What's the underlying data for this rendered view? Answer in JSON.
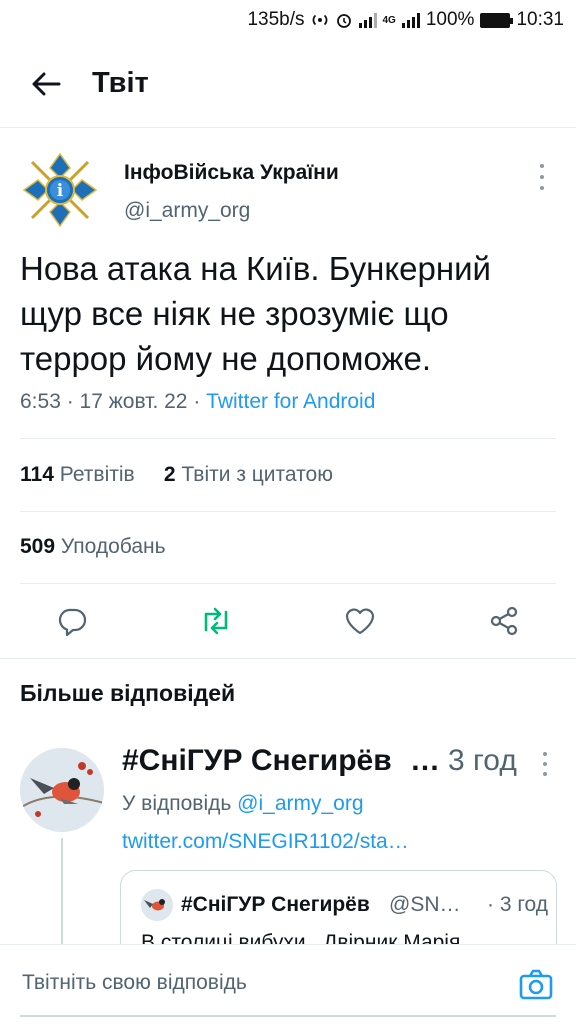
{
  "status_bar": {
    "speed": "135b/s",
    "network": "4G",
    "battery": "100%",
    "time": "10:31"
  },
  "header": {
    "title": "Твіт"
  },
  "tweet": {
    "author_name": "ІнфоВійська України",
    "author_handle": "@i_army_org",
    "text": "Нова атака на Київ. Бункерний щур все ніяк не зрозуміє що террор йому не допоможе.",
    "time": "6:53",
    "date": "17 жовт. 22",
    "source": "Twitter for Android",
    "retweets_count": "114",
    "retweets_label": "Ретвітів",
    "quotes_count": "2",
    "quotes_label": "Твіти з цитатою",
    "likes_count": "509",
    "likes_label": "Уподобань"
  },
  "more_replies_title": "Більше відповідей",
  "reply": {
    "name": "#СніГУР Снегирёв",
    "time": "3 год",
    "reply_to_label": "У відповідь",
    "reply_to_handle": "@i_army_org",
    "link": "twitter.com/SNEGIR1102/sta…",
    "quote": {
      "name": "#СніГУР Снегирёв",
      "handle": "@SN…",
      "time": "· 3 год",
      "text": "В столиці вибухи . Двірник Марія"
    }
  },
  "compose": {
    "placeholder": "Твітніть свою відповідь"
  },
  "colors": {
    "accent": "#1d9bf0",
    "retweet_active": "#00ba7c",
    "secondary_text": "#536471"
  }
}
